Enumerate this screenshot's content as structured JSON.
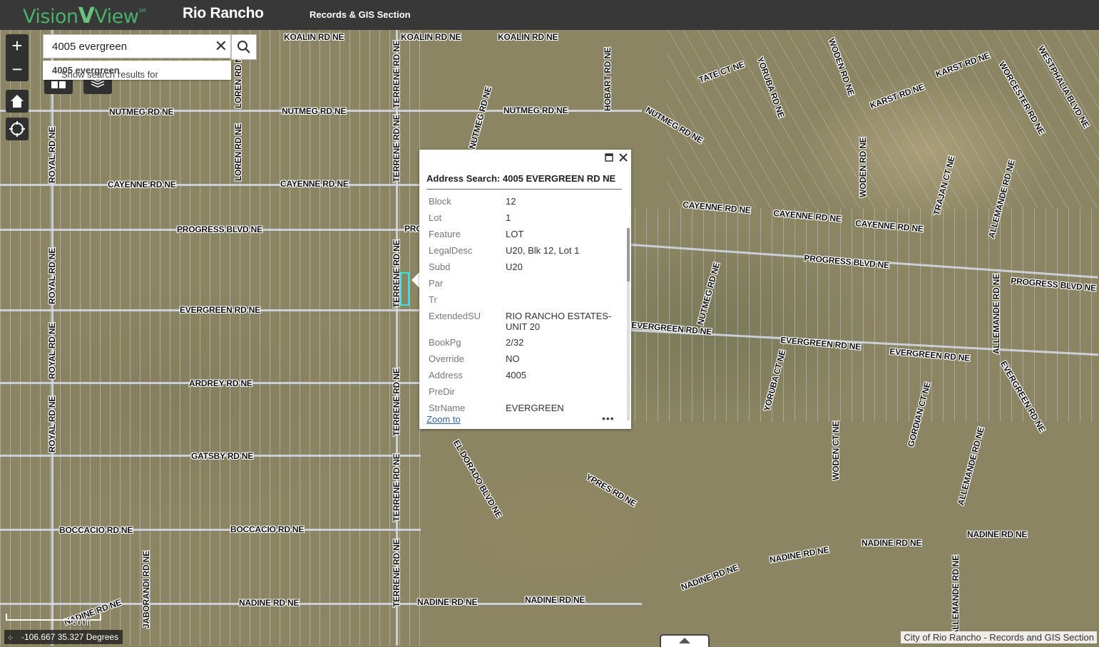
{
  "header": {
    "logo_text_1": "Vision",
    "logo_v": "V",
    "logo_text_2": "View",
    "logo_sm": "SM",
    "title": "Rio Rancho",
    "subtitle": "Records & GIS Section"
  },
  "search": {
    "value": "4005 evergreen",
    "suggestion_prefix": "Show search results for ",
    "suggestion_term": "4005 evergreen"
  },
  "controls": {
    "zoom_in": "+",
    "zoom_out": "−"
  },
  "popup": {
    "title": "Address Search: 4005 EVERGREEN RD NE",
    "fields": [
      {
        "key": "Block",
        "value": "12"
      },
      {
        "key": "Lot",
        "value": "1"
      },
      {
        "key": "Feature",
        "value": "LOT"
      },
      {
        "key": "LegalDesc",
        "value": "U20, Blk 12, Lot 1"
      },
      {
        "key": "Subd",
        "value": "U20"
      },
      {
        "key": "Par",
        "value": ""
      },
      {
        "key": "Tr",
        "value": ""
      },
      {
        "key": "ExtendedSU",
        "value": "RIO RANCHO ESTATES-UNIT 20"
      },
      {
        "key": "BookPg",
        "value": "2/32"
      },
      {
        "key": "Override",
        "value": "NO"
      },
      {
        "key": "Address",
        "value": "4005"
      },
      {
        "key": "PreDir",
        "value": ""
      },
      {
        "key": "StrName",
        "value": "EVERGREEN"
      }
    ],
    "zoom_to": "Zoom to",
    "more": "•••"
  },
  "map": {
    "labels": [
      "KOALIN RD NE",
      "KOALIN RD NE",
      "KOALIN RD NE",
      "NUTMEG RD NE",
      "NUTMEG RD NE",
      "NUTMEG RD NE",
      "NUTMEG RD NE",
      "NUTMEG RD NE",
      "CAYENNE RD NE",
      "CAYENNE RD NE",
      "CAYENNE RD NE",
      "CAYENNE RD NE",
      "CAYENNE RD NE",
      "PROGRESS BLVD NE",
      "PROGRESS BLVD NE",
      "PROGRESS BLVD NE",
      "EVERGREEN RD NE",
      "EVERGREEN RD NE",
      "EVERGREEN RD NE",
      "EVERGREEN RD NE",
      "EVERGREEN RD NE",
      "ARDREY RD NE",
      "GATSBY RD NE",
      "BOCCACIO RD NE",
      "BOCCACIO RD NE",
      "NADINE RD NE",
      "NADINE RD NE",
      "NADINE RD NE",
      "NADINE RD NE",
      "NADINE RD NE",
      "NADINE RD NE",
      "NADINE RD NE",
      "NADINE RD NE",
      "ROYAL RD NE",
      "ROYAL RD NE",
      "ROYAL RD NE",
      "ROYAL RD NE",
      "LOREN RD NE",
      "LOREN RD NE",
      "TERRENE RD NE",
      "TERRENE RD NE",
      "TERRENE RD NE",
      "TERRENE RD NE",
      "TERRENE RD NE",
      "TERRENE RD NE",
      "HOBART RD NE",
      "JABORANDI RD NE",
      "NUTMEG RD NE",
      "TATE CT NE",
      "YORUBA RD NE",
      "WODEN RD NE",
      "KARST RD NE",
      "KARST RD NE",
      "WORCESTER RD NE",
      "WESTPHALIA BLVD NE",
      "WODEN RD NE",
      "TRAJAN CT NE",
      "ALLEMANDE RD NE",
      "ALLEMANDE RD NE",
      "YORUBA CT NE",
      "GORDIAN CT NE",
      "WODEN CT NE",
      "ALLEMANDE RD NE",
      "YPRES RD NE",
      "ALLEMANDE RD NE",
      "EL DORADO BLVD NE",
      "PROGRESS BLVD NE",
      "EVERGREEN RD NE"
    ],
    "scale_label": "600ft",
    "coordinates": "-106.667 35.327 Degrees",
    "attribution": "City of Rio Rancho - Records and GIS Section"
  }
}
